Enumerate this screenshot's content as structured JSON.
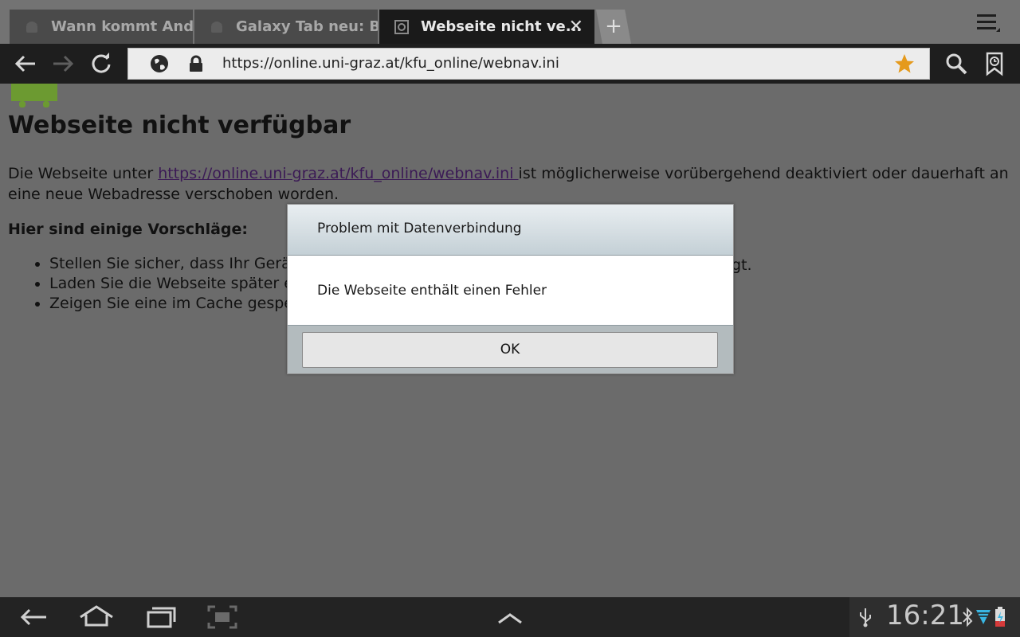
{
  "tabs": [
    {
      "title": "Wann kommt And...",
      "icon": "android-icon",
      "active": false
    },
    {
      "title": "Galaxy Tab neu: B...",
      "icon": "android-icon",
      "active": false
    },
    {
      "title": "Webseite nicht ve...",
      "icon": "page-icon",
      "active": true
    }
  ],
  "address_bar": {
    "url": "https://online.uni-graz.at/kfu_online/webnav.ini"
  },
  "page": {
    "heading": "Webseite nicht verfügbar",
    "para_before": "Die Webseite unter ",
    "link": "https://online.uni-graz.at/kfu_online/webnav.ini ",
    "para_after": " ist möglicherweise vorübergehend deaktiviert oder dauerhaft an eine neue Webadresse verschoben worden.",
    "suggestions_heading": "Hier sind einige Vorschläge:",
    "suggestions": [
      "Stellen Sie sicher, dass Ihr Gerä",
      "Laden Sie die Webseite später e",
      "Zeigen Sie eine im Cache gespe"
    ],
    "suggestion_tail": "gt."
  },
  "dialog": {
    "title": "Problem mit Datenverbindung",
    "message": "Die Webseite enthält einen Fehler",
    "ok_label": "OK"
  },
  "system_bar": {
    "time": "16:21"
  },
  "colors": {
    "link": "#3b1a55",
    "star": "#e59a1c",
    "android_green": "#8cc63e"
  }
}
